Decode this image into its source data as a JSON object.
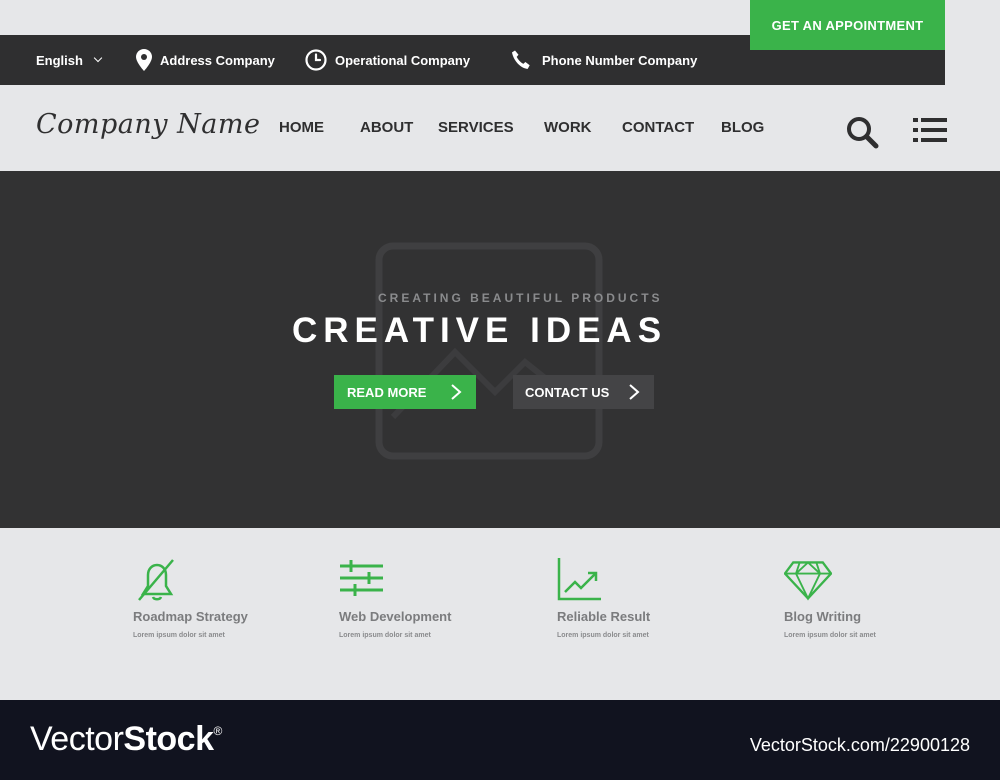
{
  "topbar": {
    "language": "English",
    "address": "Address Company",
    "operational": "Operational Company",
    "phone": "Phone Number Company",
    "appointment_button": "GET AN APPOINTMENT"
  },
  "navbar": {
    "logo": "Company Name",
    "items": [
      "HOME",
      "ABOUT",
      "SERVICES",
      "WORK",
      "CONTACT",
      "BLOG"
    ]
  },
  "hero": {
    "subtitle": "CREATING BEAUTIFUL PRODUCTS",
    "title": "CREATIVE IDEAS",
    "read_more": "READ MORE",
    "contact_us": "CONTACT US"
  },
  "features": [
    {
      "icon": "bell-off-icon",
      "title": "Roadmap Strategy",
      "desc": "Lorem ipsum dolor sit amet"
    },
    {
      "icon": "sliders-icon",
      "title": "Web Development",
      "desc": "Lorem ipsum dolor sit amet"
    },
    {
      "icon": "chart-growth-icon",
      "title": "Reliable Result",
      "desc": "Lorem ipsum dolor sit amet"
    },
    {
      "icon": "diamond-icon",
      "title": "Blog Writing",
      "desc": "Lorem ipsum dolor sit amet"
    }
  ],
  "watermark": {
    "brand_prefix": "Vector",
    "brand_bold": "Stock",
    "registered": "®",
    "url": "VectorStock.com/22900128"
  },
  "colors": {
    "accent_green": "#3ab34a",
    "dark": "#2f2f30",
    "hero_bg": "#323233",
    "light_bg": "#e6e7e9",
    "footer_bg": "#11131f"
  }
}
